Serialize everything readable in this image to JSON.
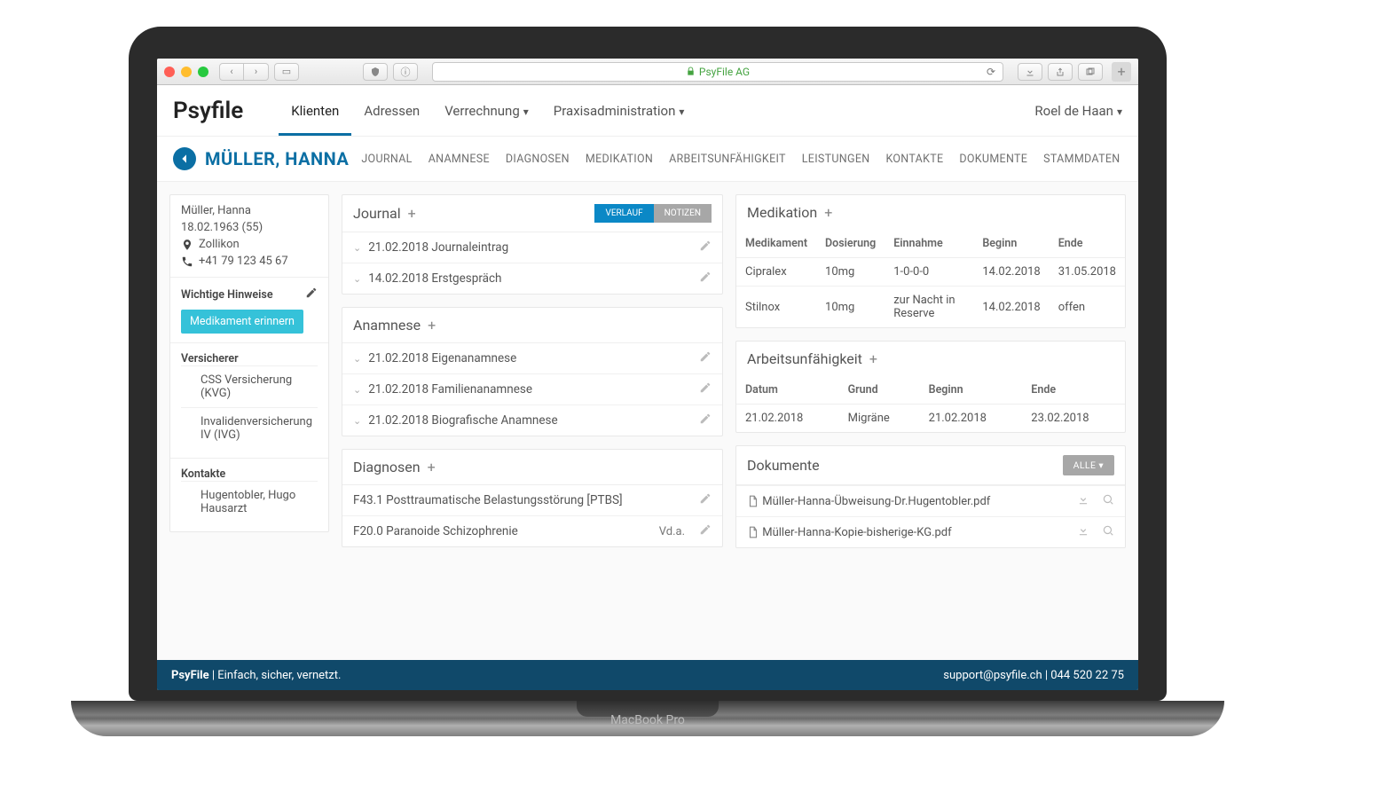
{
  "browser": {
    "url_label": "PsyFile AG"
  },
  "header": {
    "logo": "Psyfile",
    "nav": [
      "Klienten",
      "Adressen",
      "Verrechnung",
      "Praxisadministration"
    ],
    "active_nav": 0,
    "user": "Roel de Haan"
  },
  "patient": {
    "display_name": "MÜLLER, HANNA",
    "tabs": [
      "JOURNAL",
      "ANAMNESE",
      "DIAGNOSEN",
      "MEDIKATION",
      "ARBEITSUNFÄHIGKEIT",
      "LEISTUNGEN",
      "KONTAKTE",
      "DOKUMENTE",
      "STAMMDATEN"
    ]
  },
  "sidebar": {
    "name": "Müller, Hanna",
    "birth": "18.02.1963 (55)",
    "city": "Zollikon",
    "phone": "+41 79 123 45 67",
    "hints_title": "Wichtige Hinweise",
    "remember_label": "Medikament erinnern",
    "insurer_title": "Versicherer",
    "insurers": [
      "CSS Versicherung (KVG)",
      "Invalidenversicherung IV (IVG)"
    ],
    "contacts_title": "Kontakte",
    "contacts": [
      {
        "name": "Hugentobler, Hugo",
        "role": "Hausarzt"
      }
    ]
  },
  "journal": {
    "title": "Journal",
    "toggle": {
      "on": "VERLAUF",
      "off": "NOTIZEN"
    },
    "entries": [
      {
        "date": "21.02.2018",
        "label": "Journaleintrag"
      },
      {
        "date": "14.02.2018",
        "label": "Erstgespräch"
      }
    ]
  },
  "anamnese": {
    "title": "Anamnese",
    "entries": [
      {
        "date": "21.02.2018",
        "label": "Eigenanamnese"
      },
      {
        "date": "21.02.2018",
        "label": "Familienanamnese"
      },
      {
        "date": "21.02.2018",
        "label": "Biografische Anamnese"
      }
    ]
  },
  "diagnoses": {
    "title": "Diagnosen",
    "entries": [
      {
        "code": "F43.1",
        "label": "Posttraumatische Belastungsstörung [PTBS]",
        "qual": ""
      },
      {
        "code": "F20.0",
        "label": "Paranoide Schizophrenie",
        "qual": "Vd.a."
      }
    ]
  },
  "medication": {
    "title": "Medikation",
    "cols": [
      "Medikament",
      "Dosierung",
      "Einnahme",
      "Beginn",
      "Ende"
    ],
    "rows": [
      {
        "name": "Cipralex",
        "dose": "10mg",
        "intake": "1-0-0-0",
        "begin": "14.02.2018",
        "end": "31.05.2018"
      },
      {
        "name": "Stilnox",
        "dose": "10mg",
        "intake": "zur Nacht in Reserve",
        "begin": "14.02.2018",
        "end": "offen"
      }
    ]
  },
  "incapacity": {
    "title": "Arbeitsunfähigkeit",
    "cols": [
      "Datum",
      "Grund",
      "Beginn",
      "Ende"
    ],
    "rows": [
      {
        "date": "21.02.2018",
        "reason": "Migräne",
        "begin": "21.02.2018",
        "end": "23.02.2018"
      }
    ]
  },
  "documents": {
    "title": "Dokumente",
    "filter": "ALLE",
    "rows": [
      {
        "file": "Müller-Hanna-Übweisung-Dr.Hugentobler.pdf"
      },
      {
        "file": "Müller-Hanna-Kopie-bisherige-KG.pdf"
      }
    ]
  },
  "footer": {
    "brand": "PsyFile",
    "tagline": "Einfach, sicher, vernetzt.",
    "support": "support@psyfile.ch | 044 520 22 75"
  },
  "laptop_label": "MacBook Pro"
}
